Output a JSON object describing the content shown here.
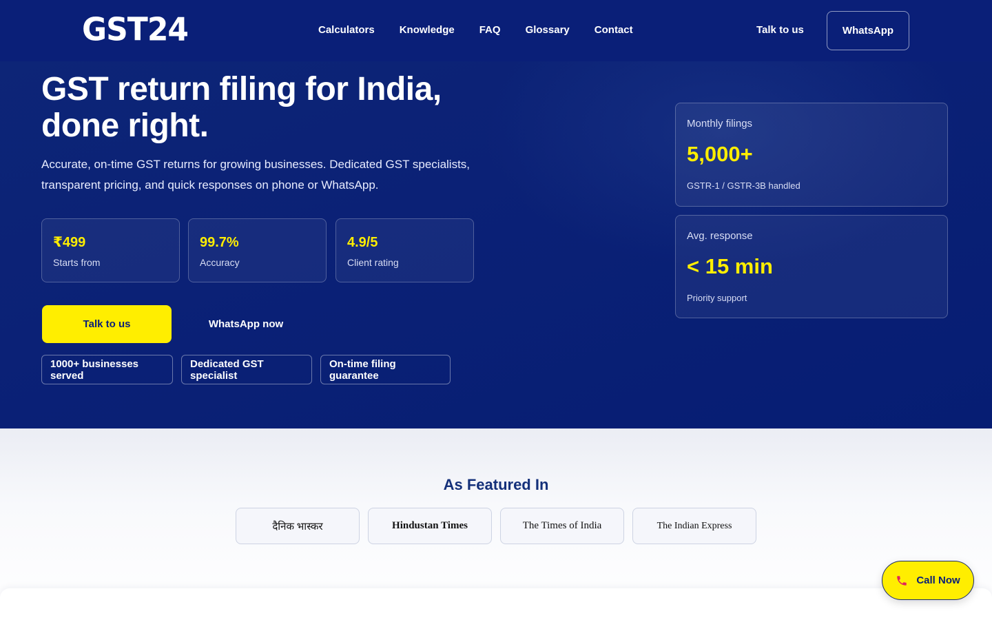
{
  "header": {
    "logo": "GST24",
    "nav": [
      "Calculators",
      "Knowledge",
      "FAQ",
      "Glossary",
      "Contact"
    ],
    "talk_label": "Talk to us",
    "whatsapp_label": "WhatsApp"
  },
  "hero": {
    "title_line1": "GST return filing for India,",
    "title_line2": "done right.",
    "subtitle": "Accurate, on-time GST returns for growing businesses. Dedicated GST specialists, transparent pricing, and quick responses on phone or WhatsApp.",
    "stats": [
      {
        "value": "₹499",
        "label": "Starts from"
      },
      {
        "value": "99.7%",
        "label": "Accuracy"
      },
      {
        "value": "4.9/5",
        "label": "Client rating"
      }
    ],
    "cta_talk": "Talk to us",
    "cta_whatsapp": "WhatsApp now",
    "chips": [
      "1000+ businesses served",
      "Dedicated GST specialist",
      "On-time filing guarantee"
    ],
    "cards": [
      {
        "key": "Monthly filings",
        "value": "5,000+",
        "detail": "GSTR-1 / GSTR-3B handled"
      },
      {
        "key": "Avg. response",
        "value": "< 15 min",
        "detail": "Priority support"
      }
    ]
  },
  "featured": {
    "title": "As Featured In",
    "outlets": [
      "दैनिक भास्कर",
      "Hindustan Times",
      "The Times of India",
      "The Indian Express"
    ]
  },
  "floating": {
    "call_label": "Call Now",
    "icon": "phone-icon"
  },
  "colors": {
    "primary": "#0a1f78",
    "accent": "#ffee00"
  }
}
